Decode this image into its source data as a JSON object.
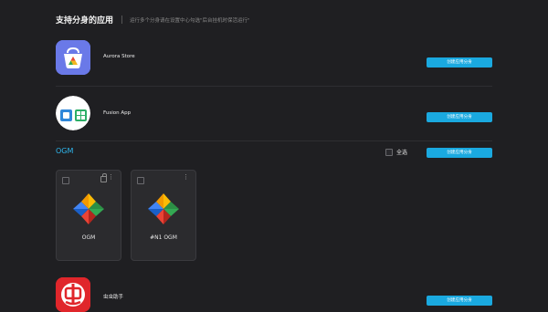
{
  "header": {
    "title": "支持分身的应用",
    "hint": "运行多个分身请在设置中心勾选\"后台挂机时保活运行\""
  },
  "apps": [
    {
      "name": "Aurora Store",
      "button": "创建应用分身"
    },
    {
      "name": "Fusion App",
      "button": "创建应用分身"
    }
  ],
  "ogm_section": {
    "title": "OGM",
    "select_all": "全选",
    "button": "创建应用分身",
    "clones": [
      {
        "name": "OGM"
      },
      {
        "name": "#N1 OGM"
      }
    ]
  },
  "bottom_app": {
    "name": "虫虫助手",
    "button": "创建应用分身"
  },
  "colors": {
    "accent": "#1aa9e0",
    "background": "#1f1f22",
    "card": "#2b2b2e"
  },
  "icons": {
    "aurora": "aurora-store-icon",
    "fusion": "fusion-app-icon",
    "ogm": "pinwheel-icon",
    "chongchong": "chongchong-icon"
  }
}
